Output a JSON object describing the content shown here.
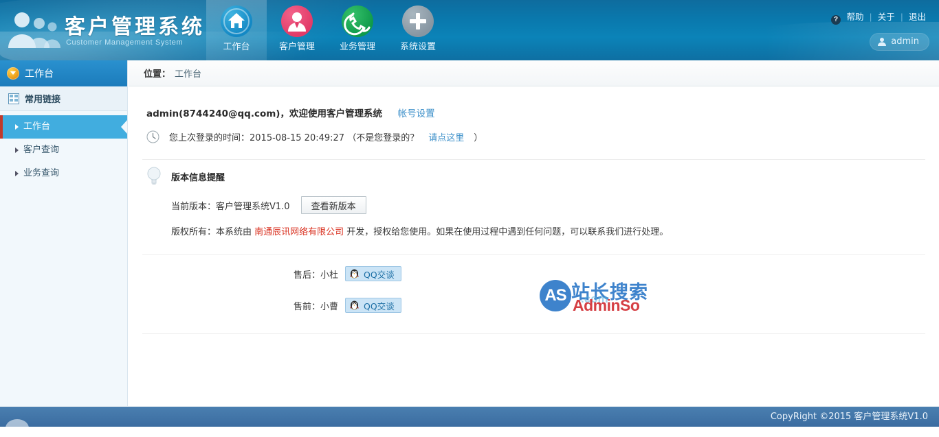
{
  "header": {
    "logo_title": "客户管理系统",
    "logo_subtitle": "Customer Management System",
    "nav": [
      {
        "label": "工作台",
        "icon": "home-icon",
        "active": true
      },
      {
        "label": "客户管理",
        "icon": "user-icon",
        "active": false
      },
      {
        "label": "业务管理",
        "icon": "phone-icon",
        "active": false
      },
      {
        "label": "系统设置",
        "icon": "plus-icon",
        "active": false
      }
    ],
    "toplinks": [
      {
        "label": "帮助",
        "icon": "question-mark-icon"
      },
      {
        "label": "关于",
        "icon": ""
      },
      {
        "label": "退出",
        "icon": ""
      }
    ],
    "user": {
      "name": "admin",
      "icon": "person-icon"
    }
  },
  "sidebar": {
    "header_label": "工作台",
    "section_label": "常用链接",
    "items": [
      {
        "label": "工作台",
        "active": true
      },
      {
        "label": "客户查询",
        "active": false
      },
      {
        "label": "业务查询",
        "active": false
      }
    ]
  },
  "breadcrumb": {
    "prefix": "位置：",
    "current": "工作台"
  },
  "main": {
    "welcome": "admin(8744240@qq.com)，欢迎使用客户管理系统",
    "account_settings_link": "帐号设置",
    "last_login": "您上次登录的时间：2015-08-15 20:49:27 （不是您登录的？",
    "last_login_link": "请点这里",
    "last_login_tail": "）",
    "version_heading": "版本信息提醒",
    "version_current": "当前版本：客户管理系统V1.0",
    "version_button": "查看新版本",
    "copyright_pre": "版权所有：本系统由 ",
    "copyright_company": "南通辰讯网络有限公司",
    "copyright_post": " 开发，授权给您使用。如果在使用过程中遇到任何问题，可以联系我们进行处理。",
    "support": [
      {
        "label": "售后：小杜",
        "button": "QQ交谈"
      },
      {
        "label": "售前：小曹",
        "button": "QQ交谈"
      }
    ],
    "watermark": {
      "logo": "AS",
      "cn": "站长搜索",
      "en": "AdminSo",
      "dot": ".com"
    }
  },
  "footer": {
    "copyright": "CopyRight ©2015 客户管理系统V1.0"
  },
  "colors": {
    "header_blue": "#0b7aae",
    "accent_blue": "#41addf",
    "link_blue": "#3b8fc9",
    "company_red": "#d9301f",
    "sidebar_bg": "#f2f8fc",
    "footer_blue": "#3b6ca0"
  }
}
